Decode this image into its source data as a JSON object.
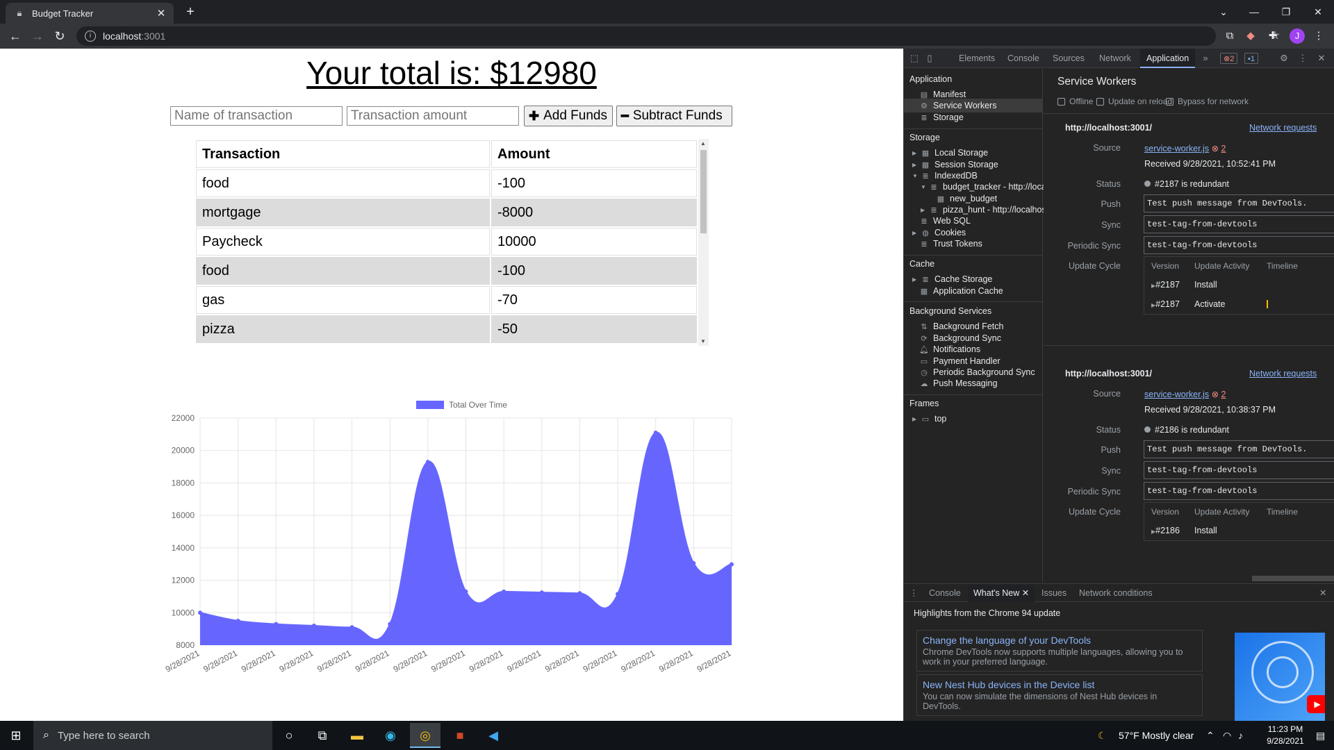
{
  "browser": {
    "tab_title": "Budget Tracker",
    "new_tab": "+",
    "url_host": "localhost",
    "url_port": ":3001",
    "avatar_letter": "J"
  },
  "page": {
    "total_text": "Your total is: $12980",
    "name_placeholder": "Name of transaction",
    "amount_placeholder": "Transaction amount",
    "add_label": "Add Funds",
    "subtract_label": "Subtract Funds",
    "table": {
      "headers": [
        "Transaction",
        "Amount"
      ],
      "rows": [
        {
          "name": "food",
          "amount": "-100"
        },
        {
          "name": "mortgage",
          "amount": "-8000"
        },
        {
          "name": "Paycheck",
          "amount": "10000"
        },
        {
          "name": "food",
          "amount": "-100"
        },
        {
          "name": "gas",
          "amount": "-70"
        },
        {
          "name": "pizza",
          "amount": "-50"
        }
      ]
    }
  },
  "chart_data": {
    "type": "area",
    "series": [
      {
        "name": "Total Over Time",
        "color": "#6666ff",
        "values": [
          10000,
          9500,
          9300,
          9200,
          9100,
          9300,
          19300,
          11300,
          11300,
          11250,
          11200,
          11150,
          21100,
          13050,
          12980
        ]
      }
    ],
    "x": [
      "9/28/2021",
      "9/28/2021",
      "9/28/2021",
      "9/28/2021",
      "9/28/2021",
      "9/28/2021",
      "9/28/2021",
      "9/28/2021",
      "9/28/2021",
      "9/28/2021",
      "9/28/2021",
      "9/28/2021",
      "9/28/2021",
      "9/28/2021",
      "9/28/2021"
    ],
    "yticks": [
      8000,
      10000,
      12000,
      14000,
      16000,
      18000,
      20000,
      22000
    ],
    "ylim": [
      8000,
      22000
    ],
    "legend_position": "top",
    "grid": true
  },
  "devtools": {
    "tabs": [
      "Elements",
      "Console",
      "Sources",
      "Network",
      "Application"
    ],
    "active_tab": "Application",
    "more": "»",
    "errors_count": "2",
    "messages_count": "1",
    "sidebar": {
      "application_header": "Application",
      "application_items": [
        "Manifest",
        "Service Workers",
        "Storage"
      ],
      "storage_header": "Storage",
      "storage_items": [
        "Local Storage",
        "Session Storage",
        "IndexedDB",
        "budget_tracker - http://loca",
        "new_budget",
        "pizza_hunt - http://localhos",
        "Web SQL",
        "Cookies",
        "Trust Tokens"
      ],
      "cache_header": "Cache",
      "cache_items": [
        "Cache Storage",
        "Application Cache"
      ],
      "bg_header": "Background Services",
      "bg_items": [
        "Background Fetch",
        "Background Sync",
        "Notifications",
        "Payment Handler",
        "Periodic Background Sync",
        "Push Messaging"
      ],
      "frames_header": "Frames",
      "frames_items": [
        "top"
      ]
    },
    "main": {
      "title": "Service Workers",
      "options": [
        "Offline",
        "Update on reload",
        "Bypass for network"
      ],
      "labels": {
        "source": "Source",
        "status": "Status",
        "push": "Push",
        "sync": "Sync",
        "periodic_sync": "Periodic Sync",
        "update_cycle": "Update Cycle"
      },
      "uc_headers": [
        "Version",
        "Update Activity",
        "Timeline"
      ],
      "workers": [
        {
          "url": "http://localhost:3001/",
          "network_requests": "Network requests",
          "source_file": "service-worker.js",
          "error_count": "2",
          "received": "Received 9/28/2021, 10:52:41 PM",
          "status": "#2187 is redundant",
          "push": "Test push message from DevTools.",
          "sync": "test-tag-from-devtools",
          "periodic_sync": "test-tag-from-devtools",
          "cycle": [
            {
              "version": "#2187",
              "activity": "Install"
            },
            {
              "version": "#2187",
              "activity": "Activate"
            }
          ]
        },
        {
          "url": "http://localhost:3001/",
          "network_requests": "Network requests",
          "source_file": "service-worker.js",
          "error_count": "2",
          "received": "Received 9/28/2021, 10:38:37 PM",
          "status": "#2186 is redundant",
          "push": "Test push message from DevTools.",
          "sync": "test-tag-from-devtools",
          "periodic_sync": "test-tag-from-devtools",
          "cycle": [
            {
              "version": "#2186",
              "activity": "Install"
            }
          ]
        }
      ]
    },
    "drawer": {
      "tabs": [
        "Console",
        "What's New",
        "Issues",
        "Network conditions"
      ],
      "active_tab": "What's New",
      "highlight": "Highlights from the Chrome 94 update",
      "cards": [
        {
          "title": "Change the language of your DevTools",
          "desc": "Chrome DevTools now supports multiple languages, allowing you to work in your preferred language."
        },
        {
          "title": "New Nest Hub devices in the Device list",
          "desc": "You can now simulate the dimensions of Nest Hub devices in DevTools."
        }
      ]
    }
  },
  "taskbar": {
    "search_placeholder": "Type here to search",
    "weather": "57°F  Mostly clear",
    "time": "11:23 PM",
    "date": "9/28/2021"
  }
}
